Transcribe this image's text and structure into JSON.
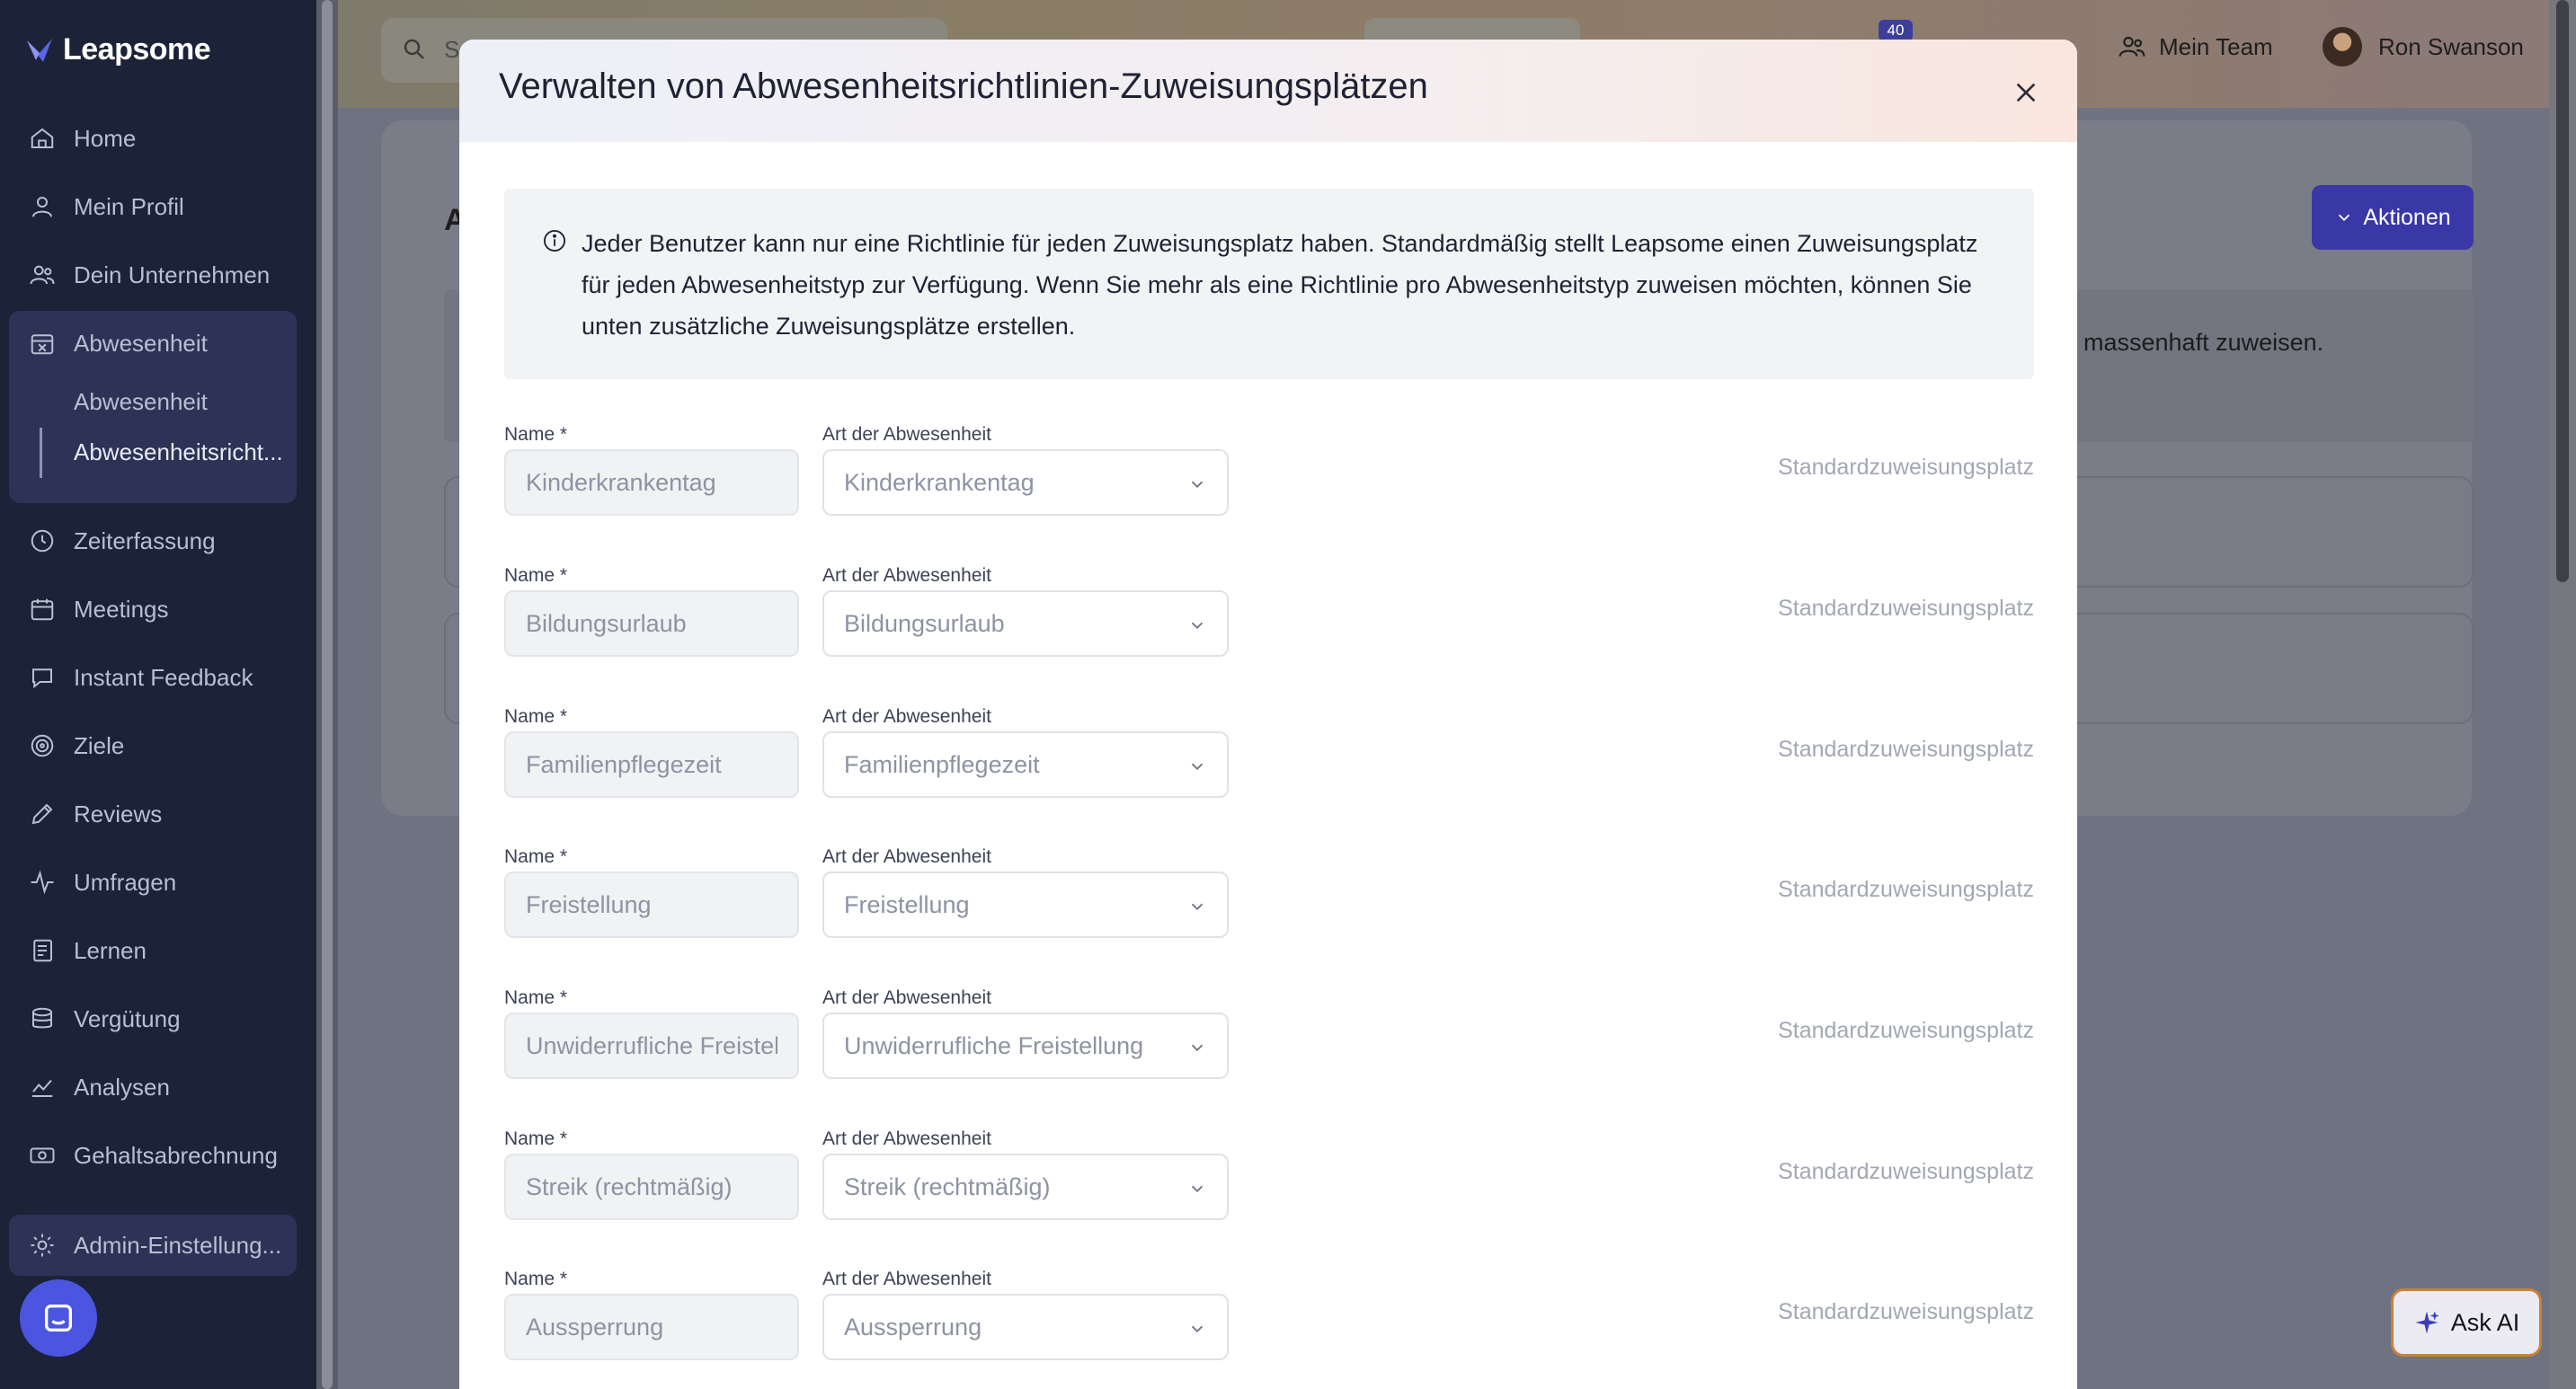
{
  "app": {
    "logo": "Leapsome"
  },
  "sidebar": {
    "items": [
      {
        "label": "Home",
        "icon": "home-icon"
      },
      {
        "label": "Mein Profil",
        "icon": "user-icon"
      },
      {
        "label": "Dein Unternehmen",
        "icon": "users-icon"
      },
      {
        "label": "Abwesenheit",
        "icon": "calendar-x-icon"
      },
      {
        "label": "Zeiterfassung",
        "icon": "clock-icon"
      },
      {
        "label": "Meetings",
        "icon": "calendar-icon"
      },
      {
        "label": "Instant Feedback",
        "icon": "chat-icon"
      },
      {
        "label": "Ziele",
        "icon": "target-icon"
      },
      {
        "label": "Reviews",
        "icon": "pen-icon"
      },
      {
        "label": "Umfragen",
        "icon": "pulse-icon"
      },
      {
        "label": "Lernen",
        "icon": "book-icon"
      },
      {
        "label": "Vergütung",
        "icon": "coins-icon"
      },
      {
        "label": "Analysen",
        "icon": "chart-icon"
      },
      {
        "label": "Gehaltsabrechnung",
        "icon": "money-icon"
      }
    ],
    "sub_items": [
      "Abwesenheit",
      "Abwesenheitsricht..."
    ],
    "admin": "Admin-Einstellung..."
  },
  "topbar": {
    "search_placeholder": "S",
    "notifications_count": "40",
    "team_label": "Mein Team",
    "user_name": "Ron Swanson"
  },
  "background": {
    "title": "A",
    "actions_label": "Aktionen",
    "strip_text": "massenhaft zuweisen."
  },
  "ask_ai": "Ask AI",
  "modal": {
    "title": "Verwalten von Abwesenheitsrichtlinien-Zuweisungsplätzen",
    "info_text": "Jeder Benutzer kann nur eine Richtlinie für jeden Zuweisungsplatz haben. Standardmäßig stellt Leapsome einen Zuweisungsplatz für jeden Abwesenheitstyp zur Verfügung. Wenn Sie mehr als eine Richtlinie pro Abwesenheitstyp zuweisen möchten, können Sie unten zusätzliche Zuweisungsplätze erstellen.",
    "name_label": "Name *",
    "type_label": "Art der Abwesenheit",
    "default_label": "Standardzuweisungsplatz",
    "rows": [
      {
        "name": "Kinderkrankentag",
        "type": "Kinderkrankentag"
      },
      {
        "name": "Bildungsurlaub",
        "type": "Bildungsurlaub"
      },
      {
        "name": "Familienpflegezeit",
        "type": "Familienpflegezeit"
      },
      {
        "name": "Freistellung",
        "type": "Freistellung"
      },
      {
        "name": "Unwiderrufliche Freistellung",
        "type": "Unwiderrufliche Freistellung"
      },
      {
        "name": "Streik (rechtmäßig)",
        "type": "Streik (rechtmäßig)"
      },
      {
        "name": "Aussperrung",
        "type": "Aussperrung"
      }
    ]
  },
  "colors": {
    "sidebar_bg": "#1c2238",
    "accent": "#4c55e0",
    "actions_button": "#3a38a6"
  }
}
